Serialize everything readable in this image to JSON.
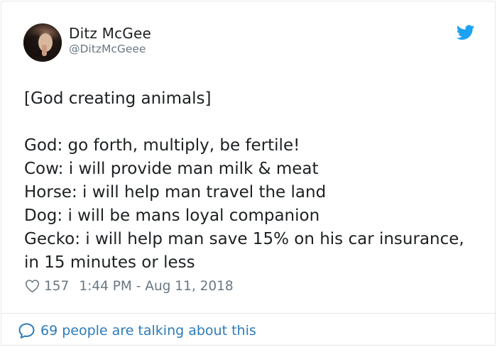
{
  "author": {
    "display_name": "Ditz McGee",
    "handle": "@DitzMcGeee"
  },
  "tweet": {
    "text": "[God creating animals]\n\nGod: go forth, multiply, be fertile!\nCow: i will provide man milk & meat\nHorse: i will help man travel the land\nDog: i will be mans loyal companion\nGecko: i will help man save 15%  on his car insurance, in 15 minutes or less"
  },
  "meta": {
    "likes": "157",
    "timestamp": "1:44 PM - Aug 11, 2018"
  },
  "footer": {
    "talking_label": "69 people are talking about this"
  },
  "colors": {
    "brand_blue": "#1da1f2",
    "link_blue": "#2b7bb9",
    "muted_text": "#697882",
    "border": "#e1e8ed"
  },
  "icons": {
    "brand": "twitter-bird-icon",
    "like": "heart-icon",
    "reply": "speech-bubble-icon"
  }
}
